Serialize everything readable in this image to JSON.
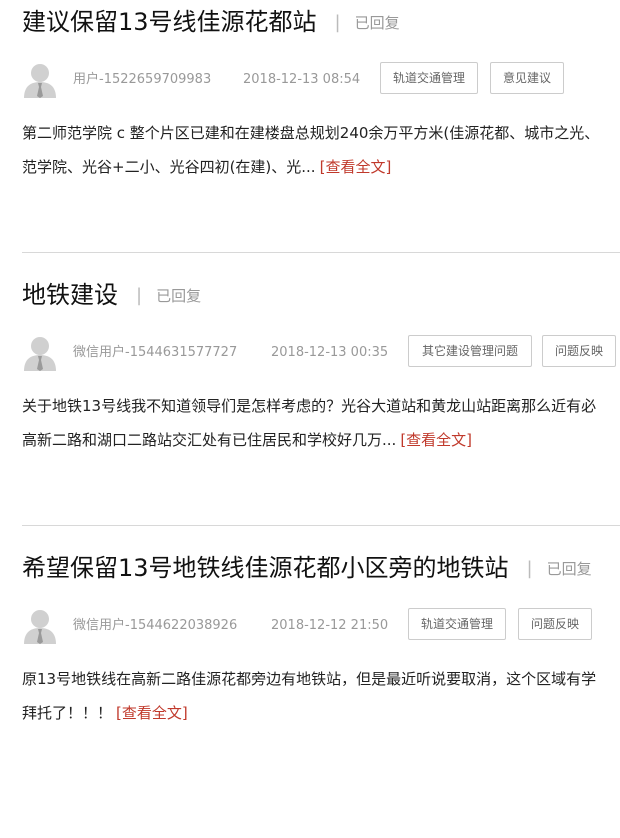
{
  "posts": [
    {
      "title": "建议保留13号线佳源花都站",
      "separator": "|",
      "status": "已回复",
      "user": "用户-1522659709983",
      "time": "2018-12-13 08:54",
      "tags": [
        "轨道交通管理",
        "意见建议"
      ],
      "excerpt_line1": "第二师范学院 c 整个片区已建和在建楼盘总规划240余万平方米(佳源花都、城市之光、",
      "excerpt_line2": "范学院、光谷+二小、光谷四初(在建)、光...",
      "read_more": "[查看全文]"
    },
    {
      "title": "地铁建设",
      "separator": "|",
      "status": "已回复",
      "user": "微信用户-1544631577727",
      "time": "2018-12-13 00:35",
      "tags": [
        "其它建设管理问题",
        "问题反映"
      ],
      "excerpt_line1": "关于地铁13号线我不知道领导们是怎样考虑的？光谷大道站和黄龙山站距离那么近有必",
      "excerpt_line2": "高新二路和湖口二路站交汇处有已住居民和学校好几万...",
      "read_more": "[查看全文]"
    },
    {
      "title": "希望保留13号地铁线佳源花都小区旁的地铁站",
      "separator": "|",
      "status": "已回复",
      "user": "微信用户-1544622038926",
      "time": "2018-12-12 21:50",
      "tags": [
        "轨道交通管理",
        "问题反映"
      ],
      "excerpt_line1": "原13号地铁线在高新二路佳源花都旁边有地铁站，但是最近听说要取消，这个区域有学",
      "excerpt_line2": "拜托了！！！",
      "read_more": "[查看全文]"
    }
  ],
  "colors": {
    "read_more": "#c0392b",
    "meta": "#999999",
    "divider": "#d8d8d8"
  },
  "icons": {
    "avatar": "default-user-avatar-icon"
  }
}
